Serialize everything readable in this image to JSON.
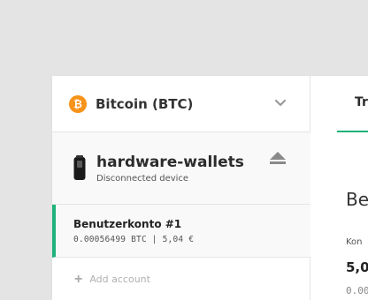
{
  "sidebar": {
    "coin": {
      "symbol_icon": "bitcoin-icon",
      "name": "Bitcoin (BTC)",
      "color": "#f7931a",
      "dropdown_icon": "chevron-down-icon"
    },
    "device": {
      "name": "hardware-wallets",
      "status": "Disconnected device",
      "icon": "hardware-wallet-icon",
      "action_icon": "eject-icon"
    },
    "accounts": [
      {
        "name": "Benutzerkonto #1",
        "balance": "0.00056499 BTC | 5,04 €",
        "selected": true
      }
    ],
    "add_account": {
      "icon": "plus-icon",
      "label": "Add account"
    }
  },
  "main": {
    "tab_label": "Tr",
    "heading": "Be",
    "balance_label": "Kon",
    "balance_value": "5,0",
    "balance_sub": "0.00"
  },
  "colors": {
    "accent": "#1fb27b",
    "bitcoin": "#f7931a"
  }
}
